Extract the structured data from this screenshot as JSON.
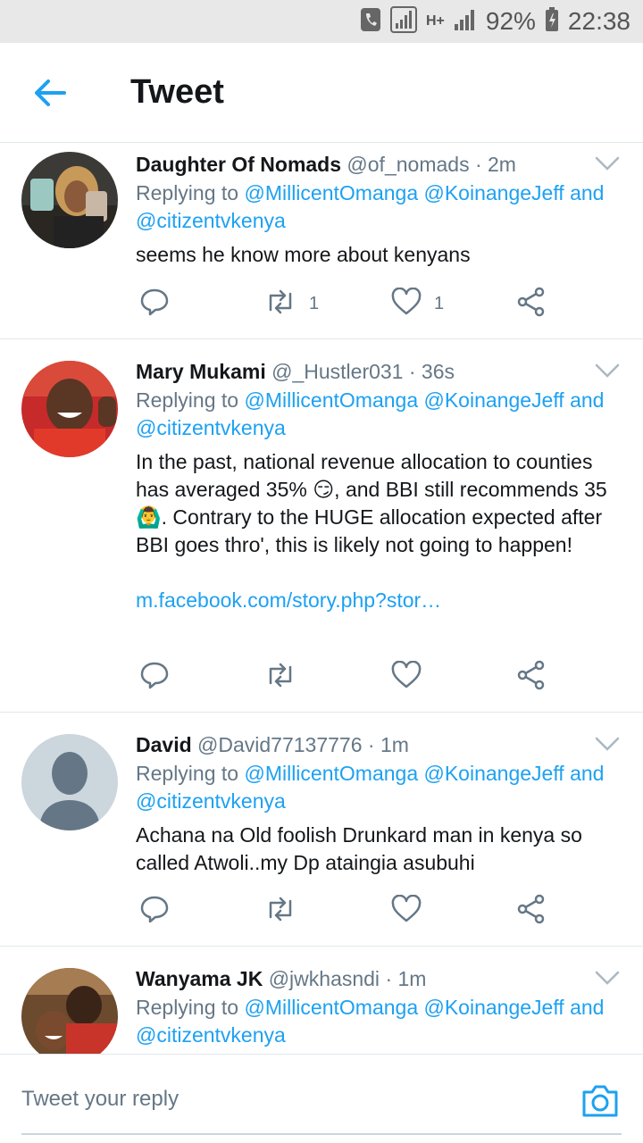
{
  "status_bar": {
    "battery": "92%",
    "time": "22:38",
    "network": "H+"
  },
  "header": {
    "title": "Tweet"
  },
  "tweets": [
    {
      "name": "Daughter Of Nomads",
      "handle": "@of_nomads",
      "time": "· 2m",
      "replying_prefix": "Replying to",
      "replying_to": "@MillicentOmanga @KoinangeJeff and @citizentvkenya",
      "text": "seems he know more about kenyans",
      "retweets": "1",
      "likes": "1"
    },
    {
      "name": "Mary Mukami",
      "handle": "@_Hustler031",
      "time": "· 36s",
      "replying_prefix": "Replying to",
      "replying_to": "@MillicentOmanga @KoinangeJeff and @citizentvkenya",
      "text": "In the past, national revenue allocation to counties has averaged 35% 😏, and BBI still recommends 35 🙆‍♂️. Contrary to the HUGE allocation expected after BBI goes thro', this is likely not going to happen!",
      "link": "m.facebook.com/story.php?stor…",
      "retweets": "",
      "likes": ""
    },
    {
      "name": "David",
      "handle": "@David77137776",
      "time": "· 1m",
      "replying_prefix": "Replying to",
      "replying_to": "@MillicentOmanga @KoinangeJeff and @citizentvkenya",
      "text": "Achana na Old foolish Drunkard man in kenya so called Atwoli..my Dp ataingia asubuhi",
      "retweets": "",
      "likes": ""
    },
    {
      "name": "Wanyama JK",
      "handle": "@jwkhasndi",
      "time": "· 1m",
      "replying_prefix": "Replying to",
      "replying_to": "@MillicentOmanga @KoinangeJeff and @citizentvkenya"
    }
  ],
  "composer": {
    "placeholder": "Tweet your reply"
  },
  "colors": {
    "accent": "#1da1f2",
    "secondary_text": "#657786",
    "divider": "#e1e8ed"
  },
  "icons": [
    "phone-icon",
    "signal-icon",
    "battery-icon",
    "back-arrow-icon",
    "chevron-down-icon",
    "reply-icon",
    "retweet-icon",
    "like-icon",
    "share-icon",
    "camera-icon"
  ]
}
